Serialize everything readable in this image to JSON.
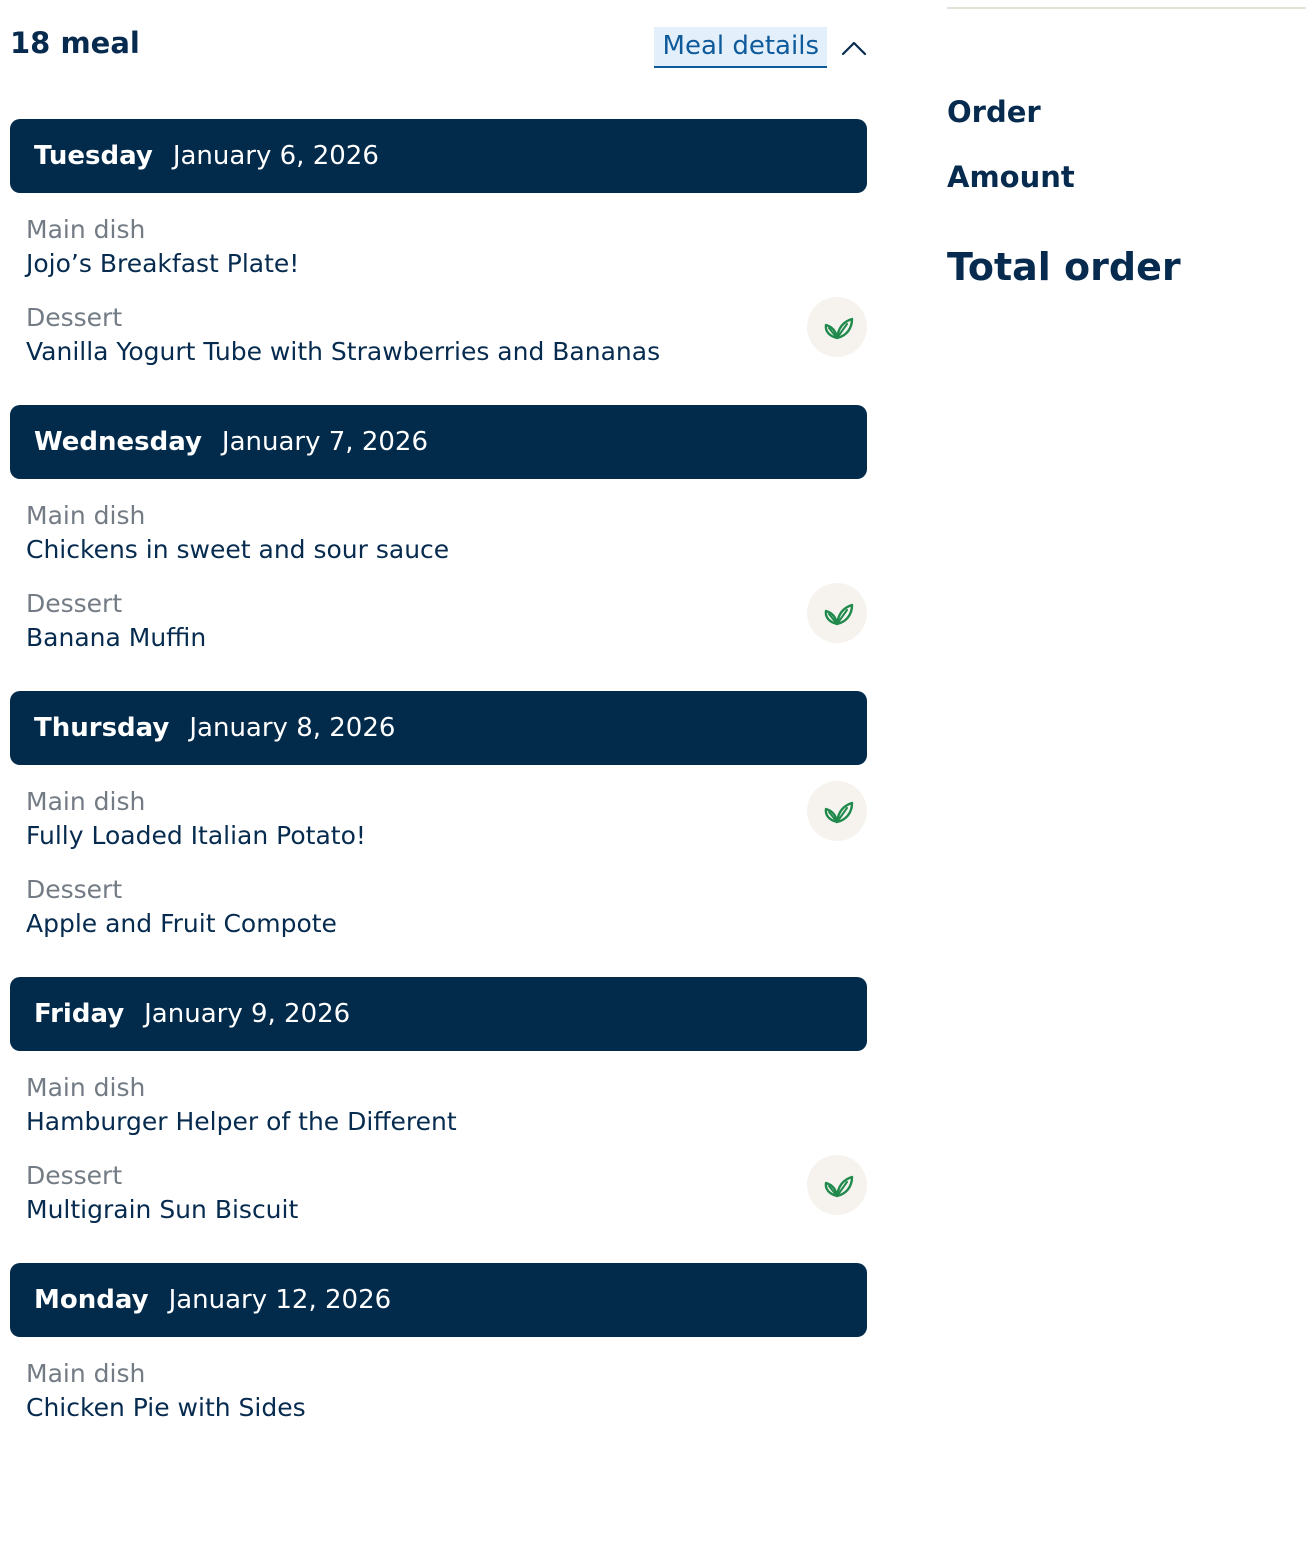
{
  "header": {
    "meal_count": "18 meal",
    "details_label": "Meal details"
  },
  "days": [
    {
      "name": "Tuesday",
      "date": "January 6, 2026",
      "main_label": "Main dish",
      "main": "Jojo’s Breakfast Plate!",
      "dessert_label": "Dessert",
      "dessert": "Vanilla Yogurt Tube with Strawberries and Bananas"
    },
    {
      "name": "Wednesday",
      "date": "January 7, 2026",
      "main_label": "Main dish",
      "main": "Chickens in sweet and sour sauce",
      "dessert_label": "Dessert",
      "dessert": "Banana Muffin"
    },
    {
      "name": "Thursday",
      "date": "January 8, 2026",
      "main_label": "Main dish",
      "main": "Fully Loaded Italian Potato!",
      "dessert_label": "Dessert",
      "dessert": "Apple and Fruit Compote"
    },
    {
      "name": "Friday",
      "date": "January 9, 2026",
      "main_label": "Main dish",
      "main": "Hamburger Helper of the Different",
      "dessert_label": "Dessert",
      "dessert": "Multigrain Sun Biscuit"
    },
    {
      "name": "Monday",
      "date": "January 12, 2026",
      "main_label": "Main dish",
      "main": "Chicken Pie with Sides",
      "dessert_label": "",
      "dessert": ""
    }
  ],
  "summary": {
    "order_label": "Order",
    "amount_label": "Amount",
    "total_label": "Total order"
  },
  "icons": {
    "vegetarian": "leaf-icon",
    "toggle": "chevron-up-icon"
  },
  "colors": {
    "navy": "#012a4b",
    "link": "#0e5a9a",
    "leaf": "#1f8a4c"
  }
}
